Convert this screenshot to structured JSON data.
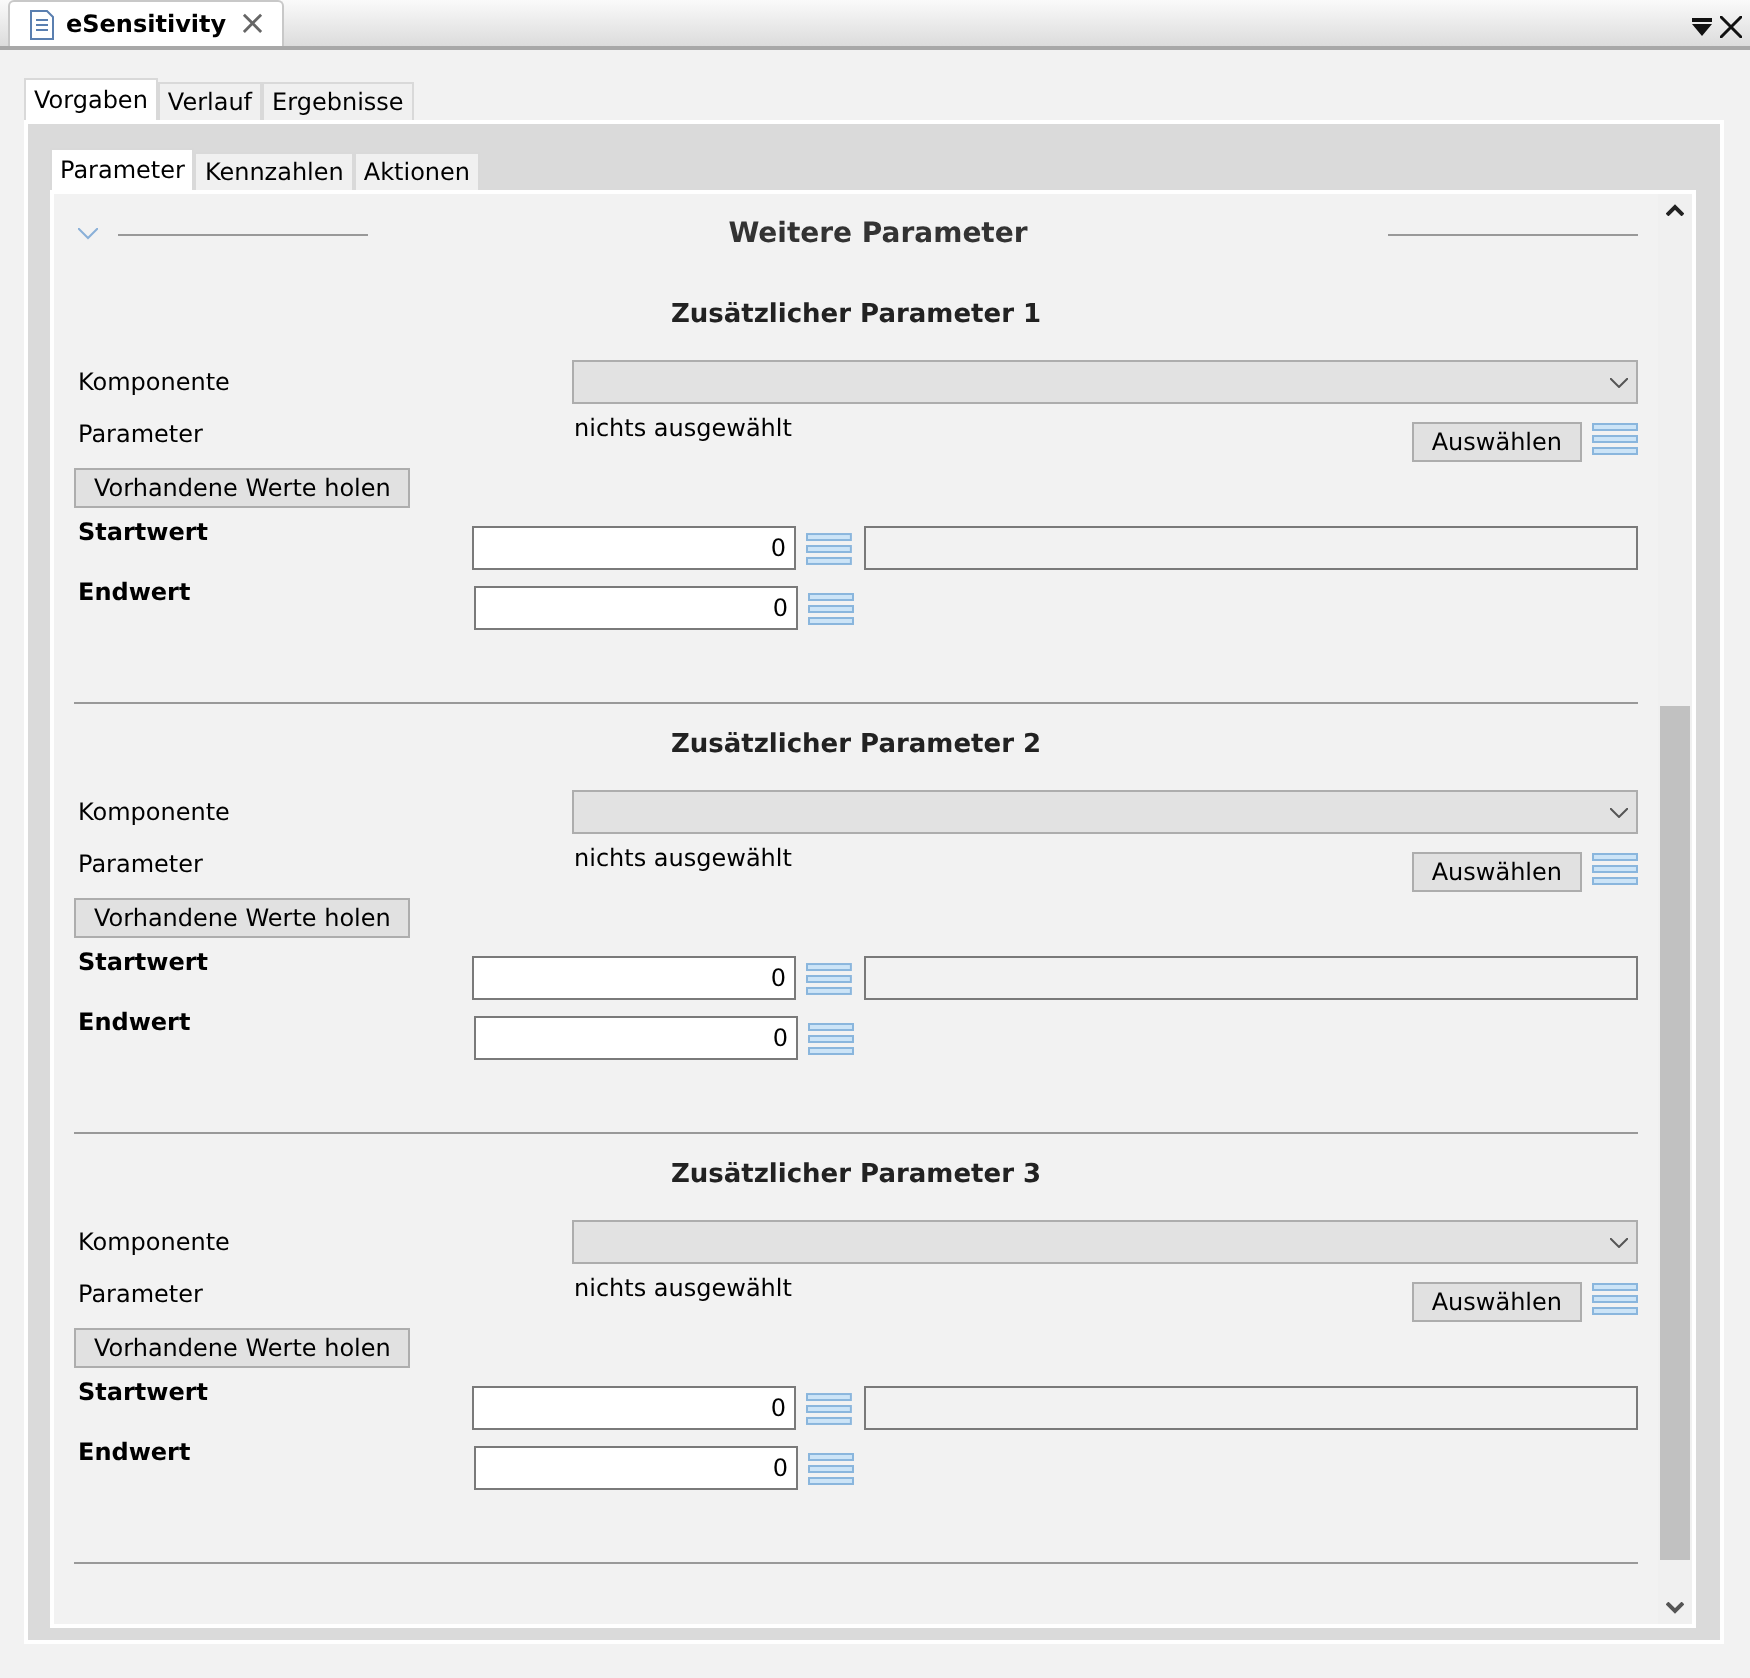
{
  "editor_tab": {
    "title": "eSensitivity",
    "close": "×"
  },
  "outer_tabs": [
    {
      "label": "Vorgaben",
      "selected": true
    },
    {
      "label": "Verlauf",
      "selected": false
    },
    {
      "label": "Ergebnisse",
      "selected": false
    }
  ],
  "inner_tabs": [
    {
      "label": "Parameter",
      "selected": true
    },
    {
      "label": "Kennzahlen",
      "selected": false
    },
    {
      "label": "Aktionen",
      "selected": false
    }
  ],
  "section": {
    "title": "Weitere Parameter",
    "expanded": true
  },
  "blocks": [
    {
      "title": "Zusätzlicher Parameter 1",
      "component_label": "Komponente",
      "parameter_label": "Parameter",
      "parameter_value": "nichts ausgewählt",
      "select_button": "Auswählen",
      "fetch_button": "Vorhandene Werte holen",
      "start_label": "Startwert",
      "start_value": "0",
      "end_label": "Endwert",
      "end_value": "0"
    },
    {
      "title": "Zusätzlicher Parameter 2",
      "component_label": "Komponente",
      "parameter_label": "Parameter",
      "parameter_value": "nichts ausgewählt",
      "select_button": "Auswählen",
      "fetch_button": "Vorhandene Werte holen",
      "start_label": "Startwert",
      "start_value": "0",
      "end_label": "Endwert",
      "end_value": "0"
    },
    {
      "title": "Zusätzlicher Parameter 3",
      "component_label": "Komponente",
      "parameter_label": "Parameter",
      "parameter_value": "nichts ausgewählt",
      "select_button": "Auswählen",
      "fetch_button": "Vorhandene Werte holen",
      "start_label": "Startwert",
      "start_value": "0",
      "end_label": "Endwert",
      "end_value": "0"
    }
  ]
}
